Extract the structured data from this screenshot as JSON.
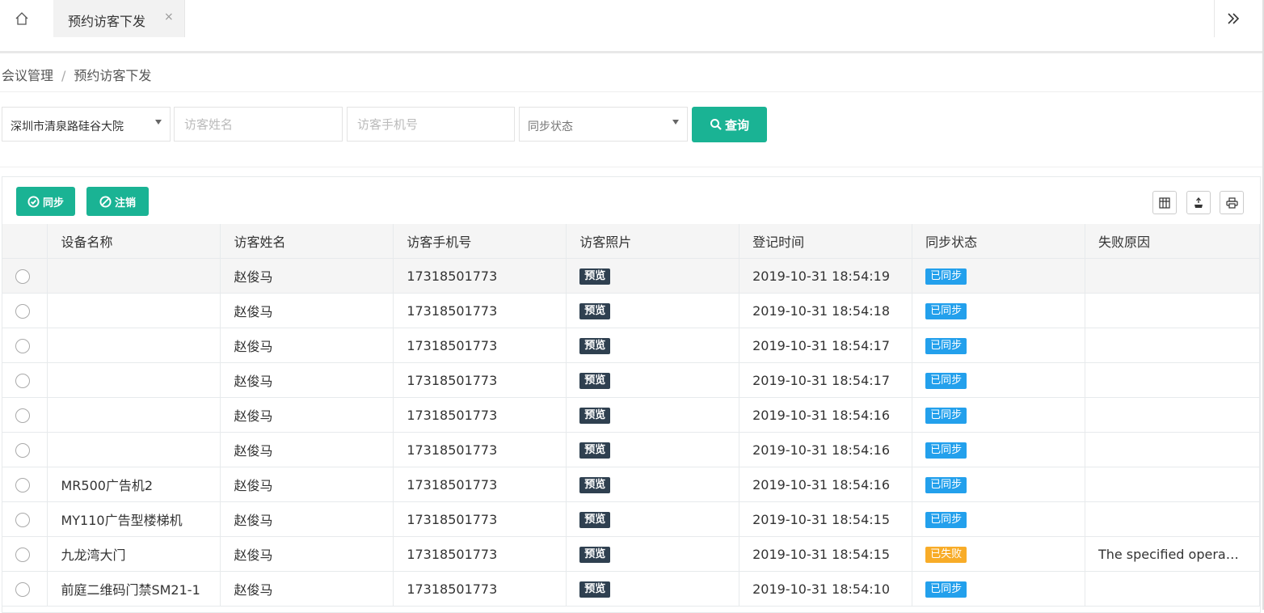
{
  "tabbar": {
    "active_tab": "预约访客下发",
    "close_glyph": "×",
    "icons": {
      "home": "home-icon",
      "more": "double-chevron-right-icon"
    }
  },
  "breadcrumb": {
    "parent": "会议管理",
    "separator": "/",
    "current": "预约访客下发"
  },
  "filters": {
    "location_value": "深圳市清泉路硅谷大院",
    "visitor_name_placeholder": "访客姓名",
    "visitor_phone_placeholder": "访客手机号",
    "sync_status_placeholder": "同步状态",
    "query_label": "查询"
  },
  "toolbar": {
    "sync_label": "同步",
    "cancel_label": "注销",
    "icons": {
      "columns": "columns-icon",
      "export": "export-icon",
      "print": "print-icon"
    }
  },
  "colors": {
    "primary": "#1ab394",
    "preview_tag": "#2f4050",
    "synced_tag": "#23a0ec",
    "failed_tag": "#f8ac28"
  },
  "table": {
    "columns": [
      "设备名称",
      "访客姓名",
      "访客手机号",
      "访客照片",
      "登记时间",
      "同步状态",
      "失败原因"
    ],
    "rows": [
      {
        "device": "",
        "name": "赵俊马",
        "phone": "17318501773",
        "photo": "预览",
        "time": "2019-10-31 18:54:19",
        "status": "已同步",
        "reason": ""
      },
      {
        "device": "",
        "name": "赵俊马",
        "phone": "17318501773",
        "photo": "预览",
        "time": "2019-10-31 18:54:18",
        "status": "已同步",
        "reason": ""
      },
      {
        "device": "",
        "name": "赵俊马",
        "phone": "17318501773",
        "photo": "预览",
        "time": "2019-10-31 18:54:17",
        "status": "已同步",
        "reason": ""
      },
      {
        "device": "",
        "name": "赵俊马",
        "phone": "17318501773",
        "photo": "预览",
        "time": "2019-10-31 18:54:17",
        "status": "已同步",
        "reason": ""
      },
      {
        "device": "",
        "name": "赵俊马",
        "phone": "17318501773",
        "photo": "预览",
        "time": "2019-10-31 18:54:16",
        "status": "已同步",
        "reason": ""
      },
      {
        "device": "",
        "name": "赵俊马",
        "phone": "17318501773",
        "photo": "预览",
        "time": "2019-10-31 18:54:16",
        "status": "已同步",
        "reason": ""
      },
      {
        "device": "MR500广告机2",
        "name": "赵俊马",
        "phone": "17318501773",
        "photo": "预览",
        "time": "2019-10-31 18:54:16",
        "status": "已同步",
        "reason": ""
      },
      {
        "device": "MY110广告型楼梯机",
        "name": "赵俊马",
        "phone": "17318501773",
        "photo": "预览",
        "time": "2019-10-31 18:54:15",
        "status": "已同步",
        "reason": ""
      },
      {
        "device": "九龙湾大门",
        "name": "赵俊马",
        "phone": "17318501773",
        "photo": "预览",
        "time": "2019-10-31 18:54:15",
        "status": "已失败",
        "reason": "The specified operation is not supported"
      },
      {
        "device": "前庭二维码门禁SM21-1",
        "name": "赵俊马",
        "phone": "17318501773",
        "photo": "预览",
        "time": "2019-10-31 18:54:10",
        "status": "已同步",
        "reason": ""
      }
    ]
  }
}
